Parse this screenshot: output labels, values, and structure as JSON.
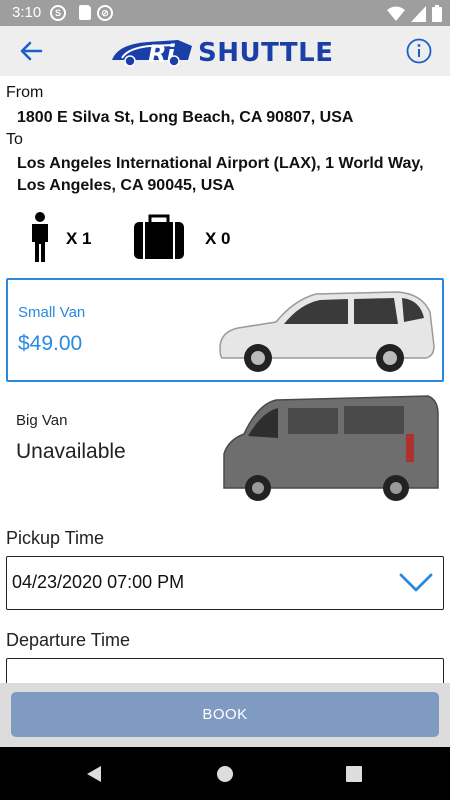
{
  "status_bar": {
    "time": "3:10"
  },
  "app_bar": {
    "logo_text": "SHUTTLE"
  },
  "trip": {
    "from_label": "From",
    "from_address": "1800 E Silva St, Long Beach, CA 90807, USA",
    "to_label": "To",
    "to_address": "Los Angeles International Airport (LAX), 1 World Way, Los Angeles, CA 90045, USA"
  },
  "counts": {
    "passengers": "X  1",
    "bags": "X  0"
  },
  "vehicles": [
    {
      "name": "Small Van",
      "price": "$49.00",
      "selected": true
    },
    {
      "name": "Big Van",
      "price": "Unavailable",
      "selected": false
    }
  ],
  "pickup": {
    "label": "Pickup Time",
    "value": "04/23/2020 07:00 PM"
  },
  "departure": {
    "label": "Departure Time",
    "value": ""
  },
  "book": {
    "label": "BOOK"
  },
  "colors": {
    "accent": "#2a8ae0",
    "book_button": "#7f9bc1",
    "logo": "#1a3fa8"
  },
  "icons": [
    "back-arrow-icon",
    "info-icon",
    "person-icon",
    "luggage-icon",
    "chevron-down-icon",
    "wifi-icon",
    "battery-icon",
    "signal-icon"
  ]
}
